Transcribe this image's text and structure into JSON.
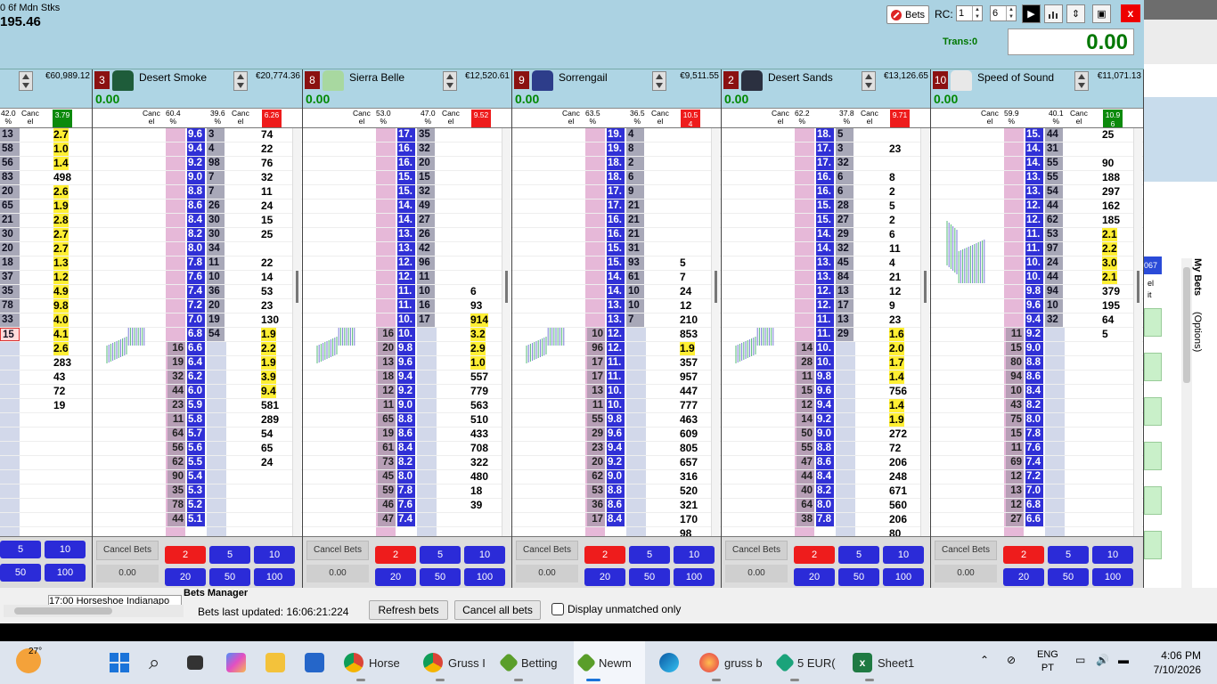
{
  "window": {
    "race_name": "0 6f Mdn Stks",
    "race_amount": "195.46",
    "bets_label": "Bets",
    "rc_label": "RC:",
    "rc_value_1": "1",
    "rc_value_2": "6",
    "trans_label": "Trans:0",
    "total_value": "0.00",
    "close_label": "x"
  },
  "panels": [
    {
      "number": "",
      "name": "",
      "money": "€60,989.12",
      "profit": "",
      "hdr": {
        "a": "42.0\n%",
        "b": "Canc\nel",
        "ltp": "3.79",
        "ltp_color": "#0c8a0c"
      },
      "lay_vols": [
        "13",
        "58",
        "56",
        "83",
        "20",
        "65",
        "21",
        "30",
        "20",
        "18",
        "37",
        "35",
        "78",
        "33",
        "15",
        "",
        "",
        "",
        "",
        "",
        "",
        "",
        ""
      ],
      "traded": [
        "2.7",
        "1.0",
        "1.4",
        "498",
        "2.6",
        "1.9",
        "2.8",
        "2.7",
        "2.7",
        "1.3",
        "1.2",
        "4.9",
        "9.8",
        "4.0",
        "4.1",
        "2.6",
        "283",
        "43",
        "72",
        "19",
        "",
        "",
        ""
      ],
      "traded_hl": [
        1,
        1,
        1,
        0,
        1,
        1,
        1,
        1,
        1,
        1,
        1,
        1,
        1,
        1,
        1,
        1,
        0,
        0,
        0,
        0,
        0,
        0,
        0
      ],
      "buttons": {
        "cancel": "",
        "val": "",
        "stakes": [
          "5",
          "10",
          "50",
          "100"
        ],
        "red": ""
      }
    },
    {
      "number": "3",
      "name": "Desert Smoke",
      "money": "€20,774.36",
      "profit": "0.00",
      "hdr": {
        "a": "Canc\nel",
        "b": "60.4\n%",
        "c": "39.6\n%",
        "d": "Canc\nel",
        "ltp": "6.26",
        "ltp_color": "#ee1c1c"
      },
      "prices": [
        "9.6",
        "9.4",
        "9.2",
        "9.0",
        "8.8",
        "8.6",
        "8.4",
        "8.2",
        "8.0",
        "7.8",
        "7.6",
        "7.4",
        "7.2",
        "7.0",
        "6.8",
        "6.6",
        "6.4",
        "6.2",
        "6.0",
        "5.9",
        "5.8",
        "5.7",
        "5.6",
        "5.5",
        "5.4",
        "5.3",
        "5.2",
        "5.1"
      ],
      "back_vols": [
        "3",
        "4",
        "98",
        "7",
        "7",
        "26",
        "30",
        "30",
        "34",
        "11",
        "10",
        "36",
        "20",
        "19",
        "54",
        "",
        "",
        "",
        "",
        "",
        "",
        "",
        "",
        "",
        "",
        "",
        "",
        ""
      ],
      "lay_vols": [
        "",
        "",
        "",
        "",
        "",
        "",
        "",
        "",
        "",
        "",
        "",
        "",
        "",
        "",
        "",
        "16",
        "19",
        "32",
        "44",
        "23",
        "11",
        "64",
        "56",
        "62",
        "90",
        "35",
        "78",
        "44"
      ],
      "traded": [
        "74",
        "22",
        "76",
        "32",
        "11",
        "24",
        "15",
        "25",
        "",
        "22",
        "14",
        "53",
        "23",
        "130",
        "1.9",
        "2.2",
        "1.9",
        "3.9",
        "9.4",
        "581",
        "289",
        "54",
        "65",
        "24"
      ],
      "traded_hl": [
        0,
        0,
        0,
        0,
        0,
        0,
        0,
        0,
        0,
        0,
        0,
        0,
        0,
        0,
        1,
        1,
        1,
        1,
        1,
        0,
        0,
        0,
        0,
        0
      ],
      "buttons": {
        "cancel": "Cancel Bets",
        "val": "0.00",
        "red": "2",
        "stakes": [
          "5",
          "10",
          "20",
          "50",
          "100"
        ]
      }
    },
    {
      "number": "8",
      "name": "Sierra Belle",
      "money": "€12,520.61",
      "profit": "0.00",
      "hdr": {
        "a": "Canc\nel",
        "b": "53.0\n%",
        "c": "47.0\n%",
        "d": "Canc\nel",
        "ltp": "9.52",
        "ltp_color": "#ee1c1c"
      },
      "prices": [
        "17.",
        "16.",
        "16.",
        "15.",
        "15.",
        "14.",
        "14.",
        "13.",
        "13.",
        "12.",
        "12.",
        "11.",
        "11.",
        "10.",
        "10.",
        "9.8",
        "9.6",
        "9.4",
        "9.2",
        "9.0",
        "8.8",
        "8.6",
        "8.4",
        "8.2",
        "8.0",
        "7.8",
        "7.6",
        "7.4"
      ],
      "back_vols": [
        "35",
        "32",
        "20",
        "15",
        "32",
        "49",
        "27",
        "26",
        "42",
        "96",
        "11",
        "10",
        "16",
        "17",
        "",
        "",
        "",
        "",
        "",
        "",
        "",
        "",
        "",
        "",
        "",
        "",
        "",
        ""
      ],
      "lay_vols": [
        "",
        "",
        "",
        "",
        "",
        "",
        "",
        "",
        "",
        "",
        "",
        "",
        "",
        "",
        "16",
        "20",
        "13",
        "18",
        "12",
        "11",
        "65",
        "19",
        "61",
        "73",
        "45",
        "59",
        "46",
        "47"
      ],
      "traded": [
        "",
        "",
        "",
        "",
        "",
        "",
        "",
        "",
        "",
        "",
        "",
        "6",
        "93",
        "914",
        "3.2",
        "2.9",
        "1.0",
        "557",
        "779",
        "563",
        "510",
        "433",
        "708",
        "322",
        "480",
        "18",
        "39"
      ],
      "traded_hl": [
        0,
        0,
        0,
        0,
        0,
        0,
        0,
        0,
        0,
        0,
        0,
        0,
        0,
        1,
        1,
        1,
        1,
        0,
        0,
        0,
        0,
        0,
        0,
        0,
        0,
        0,
        0
      ],
      "buttons": {
        "cancel": "Cancel Bets",
        "val": "0.00",
        "red": "2",
        "stakes": [
          "5",
          "10",
          "20",
          "50",
          "100"
        ]
      }
    },
    {
      "number": "9",
      "name": "Sorrengail",
      "money": "€9,511.55",
      "profit": "0.00",
      "hdr": {
        "a": "Canc\nel",
        "b": "63.5\n%",
        "c": "36.5\n%",
        "d": "Canc\nel",
        "ltp": "10.5\n4",
        "ltp_color": "#ee1c1c"
      },
      "prices": [
        "19.",
        "19.",
        "18.",
        "18.",
        "17.",
        "17.",
        "16.",
        "16.",
        "15.",
        "15.",
        "14.",
        "14.",
        "13.",
        "13.",
        "12.",
        "12.",
        "11.",
        "11.",
        "10.",
        "10.",
        "9.8",
        "9.6",
        "9.4",
        "9.2",
        "9.0",
        "8.8",
        "8.6",
        "8.4"
      ],
      "back_vols": [
        "4",
        "8",
        "2",
        "6",
        "9",
        "21",
        "21",
        "21",
        "31",
        "93",
        "61",
        "10",
        "10",
        "7",
        "",
        "",
        "",
        "",
        "",
        "",
        "",
        "",
        "",
        "",
        "",
        "",
        "",
        ""
      ],
      "lay_vols": [
        "",
        "",
        "",
        "",
        "",
        "",
        "",
        "",
        "",
        "",
        "",
        "",
        "",
        "",
        "10",
        "96",
        "17",
        "17",
        "13",
        "11",
        "55",
        "29",
        "23",
        "20",
        "62",
        "53",
        "36",
        "17"
      ],
      "traded": [
        "",
        "",
        "",
        "",
        "",
        "",
        "",
        "",
        "",
        "5",
        "7",
        "24",
        "12",
        "210",
        "853",
        "1.9",
        "357",
        "957",
        "447",
        "777",
        "463",
        "609",
        "805",
        "657",
        "316",
        "520",
        "321",
        "170",
        "98"
      ],
      "traded_hl": [
        0,
        0,
        0,
        0,
        0,
        0,
        0,
        0,
        0,
        0,
        0,
        0,
        0,
        0,
        0,
        1,
        0,
        0,
        0,
        0,
        0,
        0,
        0,
        0,
        0,
        0,
        0,
        0,
        0
      ],
      "buttons": {
        "cancel": "Cancel Bets",
        "val": "0.00",
        "red": "2",
        "stakes": [
          "5",
          "10",
          "20",
          "50",
          "100"
        ]
      }
    },
    {
      "number": "2",
      "name": "Desert Sands",
      "money": "€13,126.65",
      "profit": "0.00",
      "hdr": {
        "a": "Canc\nel",
        "b": "62.2\n%",
        "c": "37.8\n%",
        "d": "Canc\nel",
        "ltp": "9.71",
        "ltp_color": "#ee1c1c"
      },
      "prices": [
        "18.",
        "17.",
        "17.",
        "16.",
        "16.",
        "15.",
        "15.",
        "14.",
        "14.",
        "13.",
        "13.",
        "12.",
        "12.",
        "11.",
        "11.",
        "10.",
        "10.",
        "9.8",
        "9.6",
        "9.4",
        "9.2",
        "9.0",
        "8.8",
        "8.6",
        "8.4",
        "8.2",
        "8.0",
        "7.8"
      ],
      "back_vols": [
        "5",
        "3",
        "32",
        "6",
        "6",
        "28",
        "27",
        "29",
        "32",
        "45",
        "84",
        "13",
        "17",
        "13",
        "29",
        "",
        "",
        "",
        "",
        "",
        "",
        "",
        "",
        "",
        "",
        "",
        "",
        ""
      ],
      "lay_vols": [
        "",
        "",
        "",
        "",
        "",
        "",
        "",
        "",
        "",
        "",
        "",
        "",
        "",
        "",
        "",
        "14",
        "28",
        "11",
        "15",
        "12",
        "14",
        "50",
        "55",
        "47",
        "44",
        "40",
        "64",
        "38"
      ],
      "traded": [
        "",
        "23",
        "",
        "8",
        "2",
        "5",
        "2",
        "6",
        "11",
        "4",
        "21",
        "12",
        "9",
        "23",
        "1.6",
        "2.0",
        "1.7",
        "1.4",
        "756",
        "1.4",
        "1.9",
        "272",
        "72",
        "206",
        "248",
        "671",
        "560",
        "206",
        "80"
      ],
      "traded_hl": [
        0,
        0,
        0,
        0,
        0,
        0,
        0,
        0,
        0,
        0,
        0,
        0,
        0,
        0,
        1,
        1,
        1,
        1,
        0,
        1,
        1,
        0,
        0,
        0,
        0,
        0,
        0,
        0,
        0
      ],
      "buttons": {
        "cancel": "Cancel Bets",
        "val": "0.00",
        "red": "2",
        "stakes": [
          "5",
          "10",
          "20",
          "50",
          "100"
        ]
      }
    },
    {
      "number": "10",
      "name": "Speed of Sound",
      "money": "€11,071.13",
      "profit": "0.00",
      "hdr": {
        "a": "Canc\nel",
        "b": "59.9\n%",
        "c": "40.1\n%",
        "d": "Canc\nel",
        "ltp": "10.9\n6",
        "ltp_color": "#0c8a0c"
      },
      "prices": [
        "15.",
        "14.",
        "14.",
        "13.",
        "13.",
        "12.",
        "12.",
        "11.",
        "11.",
        "10.",
        "10.",
        "9.8",
        "9.6",
        "9.4",
        "9.2",
        "9.0",
        "8.8",
        "8.6",
        "8.4",
        "8.2",
        "8.0",
        "7.8",
        "7.6",
        "7.4",
        "7.2",
        "7.0",
        "6.8",
        "6.6"
      ],
      "back_vols": [
        "44",
        "31",
        "55",
        "55",
        "54",
        "44",
        "62",
        "53",
        "97",
        "24",
        "44",
        "94",
        "10",
        "32",
        "",
        "",
        "",
        "",
        "",
        "",
        "",
        "",
        "",
        "",
        "",
        "",
        "",
        ""
      ],
      "lay_vols": [
        "",
        "",
        "",
        "",
        "",
        "",
        "",
        "",
        "",
        "",
        "",
        "",
        "",
        "",
        "11",
        "15",
        "80",
        "94",
        "10",
        "43",
        "75",
        "15",
        "11",
        "69",
        "12",
        "13",
        "12",
        "27"
      ],
      "traded": [
        "25",
        "",
        "90",
        "188",
        "297",
        "162",
        "185",
        "2.1",
        "2.2",
        "3.0",
        "2.1",
        "379",
        "195",
        "64",
        "5"
      ],
      "traded_hl": [
        0,
        0,
        0,
        0,
        0,
        0,
        0,
        1,
        1,
        1,
        1,
        0,
        0,
        0,
        0
      ],
      "buttons": {
        "cancel": "Cancel Bets",
        "val": "0.00",
        "red": "2",
        "stakes": [
          "5",
          "10",
          "20",
          "50",
          "100"
        ]
      }
    }
  ],
  "right_panel": {
    "my_bets": "My Bets",
    "options": "(Options)",
    "badge": "067",
    "text1": "el",
    "text2": "it"
  },
  "bets_manager": {
    "title": "Bets Manager",
    "race_item": "17:00 Horseshoe Indianapo",
    "updated": "Bets last updated: 16:06:21:224",
    "refresh": "Refresh bets",
    "cancel_all": "Cancel all bets",
    "unmatched": "Display unmatched only"
  },
  "taskbar": {
    "temp": "27°",
    "items": [
      "Horse",
      "Gruss I",
      "Betting",
      "Newm",
      "",
      "gruss b",
      "5 EUR(",
      "Sheet1"
    ],
    "lang1": "ENG",
    "lang2": "PT",
    "time": "4:06 PM",
    "date": "7/10/2026"
  }
}
